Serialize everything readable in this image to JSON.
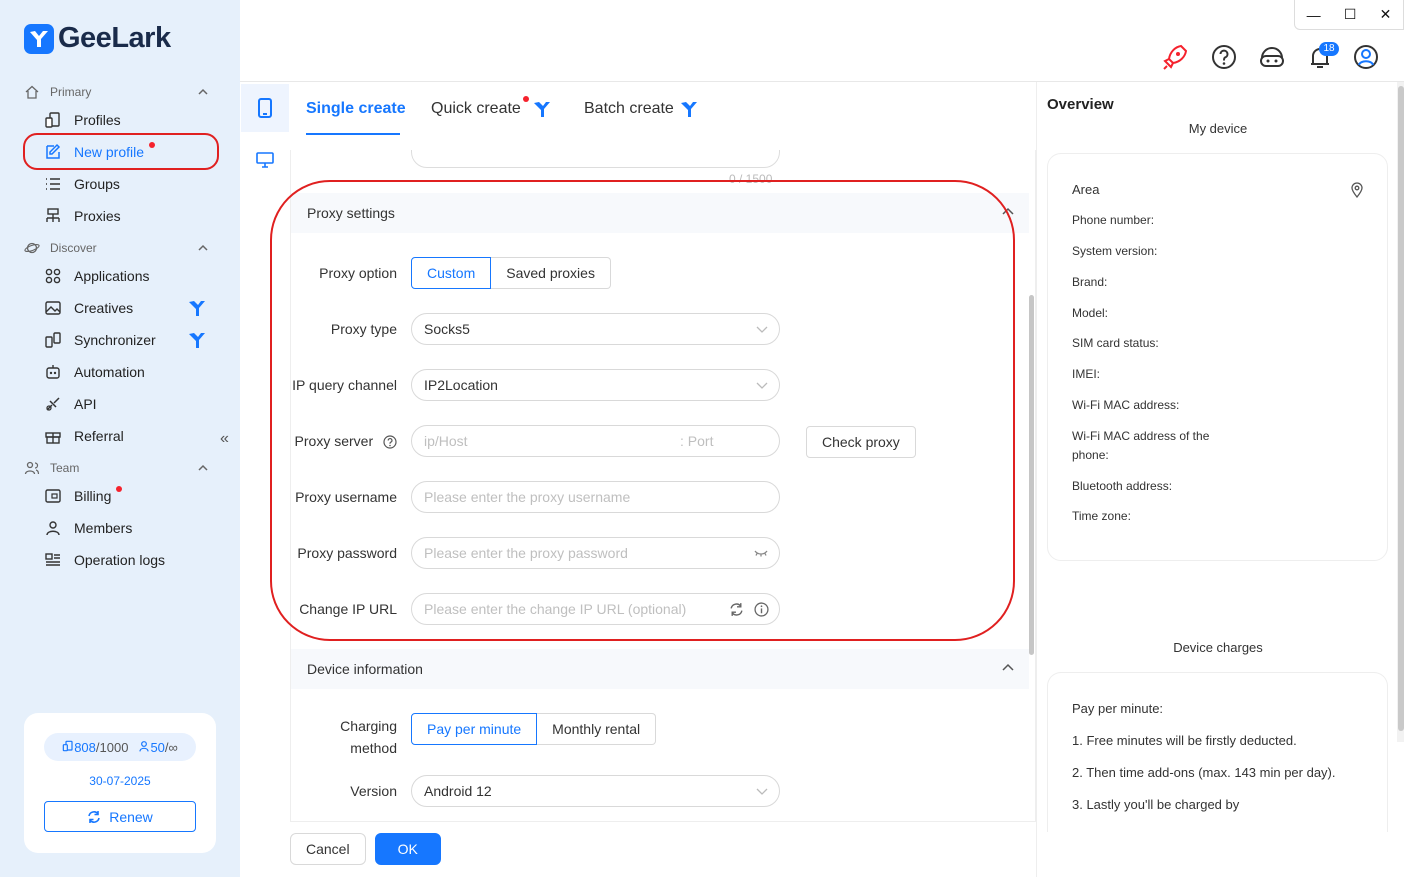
{
  "app": {
    "brand": "GeeLark"
  },
  "window_controls": {
    "minimize": "—",
    "maximize": "☐",
    "close": "✕"
  },
  "header": {
    "notification_count": "18"
  },
  "sidebar": {
    "primary_label": "Primary",
    "discover_label": "Discover",
    "team_label": "Team",
    "items": {
      "profiles": "Profiles",
      "new_profile": "New profile",
      "groups": "Groups",
      "proxies": "Proxies",
      "applications": "Applications",
      "creatives": "Creatives",
      "synchronizer": "Synchronizer",
      "automation": "Automation",
      "api": "API",
      "referral": "Referral",
      "billing": "Billing",
      "members": "Members",
      "operation_logs": "Operation logs"
    },
    "collapse": "«",
    "account": {
      "profiles_used": "808",
      "profiles_total": "/1000",
      "members_used": "50",
      "members_total": "/∞",
      "expiry": "30-07-2025",
      "renew": "Renew"
    }
  },
  "tabs": {
    "single": "Single create",
    "quick": "Quick create",
    "batch": "Batch create"
  },
  "form": {
    "counter": "0 / 1500",
    "proxy_section": "Proxy settings",
    "proxy_option_label": "Proxy option",
    "proxy_option_custom": "Custom",
    "proxy_option_saved": "Saved proxies",
    "proxy_type_label": "Proxy type",
    "proxy_type_value": "Socks5",
    "ip_channel_label": "IP query channel",
    "ip_channel_value": "IP2Location",
    "proxy_server_label": "Proxy server",
    "proxy_host_placeholder": "ip/Host",
    "proxy_port_placeholder": ": Port",
    "check_proxy": "Check proxy",
    "proxy_username_label": "Proxy username",
    "proxy_username_placeholder": "Please enter the proxy username",
    "proxy_password_label": "Proxy password",
    "proxy_password_placeholder": "Please enter the proxy password",
    "change_ip_label": "Change IP URL",
    "change_ip_placeholder": "Please enter the change IP URL (optional)",
    "device_section": "Device information",
    "charging_label_1": "Charging",
    "charging_label_2": "method",
    "charging_ppm": "Pay per minute",
    "charging_monthly": "Monthly rental",
    "version_label": "Version",
    "version_value": "Android 12"
  },
  "footer": {
    "cancel": "Cancel",
    "ok": "OK"
  },
  "overview": {
    "title": "Overview",
    "my_device": "My device",
    "area": "Area",
    "phone_number": "Phone number:",
    "system_version": "System version:",
    "brand": "Brand:",
    "model": "Model:",
    "sim_status": "SIM card status:",
    "imei": "IMEI:",
    "wifi_mac": "Wi-Fi MAC address:",
    "wifi_mac_phone": "Wi-Fi MAC address of the phone:",
    "bluetooth": "Bluetooth address:",
    "time_zone": "Time zone:",
    "device_charges": "Device charges",
    "pay_per_minute": "Pay per minute:",
    "charge_1": "1. Free minutes will be firstly deducted.",
    "charge_2": "2. Then time add-ons (max. 143 min per day).",
    "charge_3": "3. Lastly you'll be charged by"
  },
  "colors": {
    "accent": "#1677ff",
    "highlight": "#e02020",
    "sidebar_bg": "#e6f0fb"
  }
}
